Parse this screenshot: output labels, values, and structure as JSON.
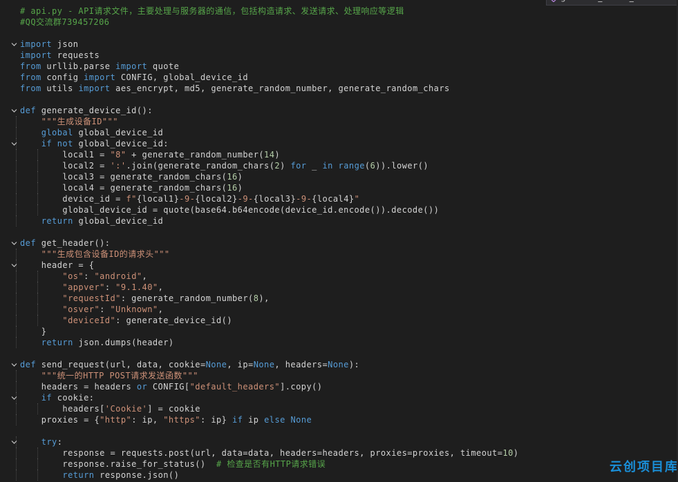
{
  "tab": {
    "label": "generate_device_id"
  },
  "watermark": "云创项目库",
  "lines": [
    {
      "segs": [
        [
          "cmt",
          "# api.py - API请求文件，主要处理与服务器的通信，包括构造请求、发送请求、处理响应等逻辑"
        ]
      ]
    },
    {
      "segs": [
        [
          "cmt",
          "#QQ交流群739457206"
        ]
      ]
    },
    {
      "segs": []
    },
    {
      "fold": true,
      "segs": [
        [
          "kw",
          "import"
        ],
        [
          "p",
          " json"
        ]
      ]
    },
    {
      "segs": [
        [
          "kw",
          "import"
        ],
        [
          "p",
          " requests"
        ]
      ]
    },
    {
      "segs": [
        [
          "kw",
          "from"
        ],
        [
          "p",
          " urllib.parse "
        ],
        [
          "kw",
          "import"
        ],
        [
          "p",
          " quote"
        ]
      ]
    },
    {
      "segs": [
        [
          "kw",
          "from"
        ],
        [
          "p",
          " config "
        ],
        [
          "kw",
          "import"
        ],
        [
          "p",
          " CONFIG, global_device_id"
        ]
      ]
    },
    {
      "segs": [
        [
          "kw",
          "from"
        ],
        [
          "p",
          " utils "
        ],
        [
          "kw",
          "import"
        ],
        [
          "p",
          " aes_encrypt, md5, generate_random_number, generate_random_chars"
        ]
      ]
    },
    {
      "segs": []
    },
    {
      "fold": true,
      "segs": [
        [
          "kw",
          "def"
        ],
        [
          "p",
          " generate_device_id():"
        ]
      ]
    },
    {
      "segs": [
        [
          "p",
          "    "
        ],
        [
          "str",
          "\"\"\"生成设备ID\"\"\""
        ]
      ]
    },
    {
      "segs": [
        [
          "p",
          "    "
        ],
        [
          "kw",
          "global"
        ],
        [
          "p",
          " global_device_id"
        ]
      ]
    },
    {
      "fold": true,
      "segs": [
        [
          "p",
          "    "
        ],
        [
          "ctl",
          "if"
        ],
        [
          "p",
          " "
        ],
        [
          "kw",
          "not"
        ],
        [
          "p",
          " global_device_id:"
        ]
      ]
    },
    {
      "segs": [
        [
          "p",
          "        local1 = "
        ],
        [
          "str",
          "\"8\""
        ],
        [
          "p",
          " + generate_random_number("
        ],
        [
          "num",
          "14"
        ],
        [
          "p",
          ")"
        ]
      ]
    },
    {
      "segs": [
        [
          "p",
          "        local2 = "
        ],
        [
          "str",
          "':'"
        ],
        [
          "p",
          ".join(generate_random_chars("
        ],
        [
          "num",
          "2"
        ],
        [
          "p",
          ") "
        ],
        [
          "ctl",
          "for"
        ],
        [
          "p",
          " _ "
        ],
        [
          "ctl",
          "in"
        ],
        [
          "p",
          " "
        ],
        [
          "kw",
          "range"
        ],
        [
          "p",
          "("
        ],
        [
          "num",
          "6"
        ],
        [
          "p",
          ")).lower()"
        ]
      ]
    },
    {
      "segs": [
        [
          "p",
          "        local3 = generate_random_chars("
        ],
        [
          "num",
          "16"
        ],
        [
          "p",
          ")"
        ]
      ]
    },
    {
      "segs": [
        [
          "p",
          "        local4 = generate_random_chars("
        ],
        [
          "num",
          "16"
        ],
        [
          "p",
          ")"
        ]
      ]
    },
    {
      "segs": [
        [
          "p",
          "        device_id = "
        ],
        [
          "str",
          "f\""
        ],
        [
          "p",
          "{local1}"
        ],
        [
          "str",
          "-9-"
        ],
        [
          "p",
          "{local2}"
        ],
        [
          "str",
          "-9-"
        ],
        [
          "p",
          "{local3}"
        ],
        [
          "str",
          "-9-"
        ],
        [
          "p",
          "{local4}"
        ],
        [
          "str",
          "\""
        ]
      ]
    },
    {
      "segs": [
        [
          "p",
          "        global_device_id = quote(base64.b64encode(device_id.encode()).decode())"
        ]
      ]
    },
    {
      "segs": [
        [
          "p",
          "    "
        ],
        [
          "ctl",
          "return"
        ],
        [
          "p",
          " global_device_id"
        ]
      ]
    },
    {
      "segs": []
    },
    {
      "fold": true,
      "segs": [
        [
          "kw",
          "def"
        ],
        [
          "p",
          " get_header():"
        ]
      ]
    },
    {
      "segs": [
        [
          "p",
          "    "
        ],
        [
          "str",
          "\"\"\"生成包含设备ID的请求头\"\"\""
        ]
      ]
    },
    {
      "fold": true,
      "segs": [
        [
          "p",
          "    header = {"
        ]
      ]
    },
    {
      "segs": [
        [
          "p",
          "        "
        ],
        [
          "str",
          "\"os\""
        ],
        [
          "p",
          ": "
        ],
        [
          "str",
          "\"android\""
        ],
        [
          "p",
          ","
        ]
      ]
    },
    {
      "segs": [
        [
          "p",
          "        "
        ],
        [
          "str",
          "\"appver\""
        ],
        [
          "p",
          ": "
        ],
        [
          "str",
          "\"9.1.40\""
        ],
        [
          "p",
          ","
        ]
      ]
    },
    {
      "segs": [
        [
          "p",
          "        "
        ],
        [
          "str",
          "\"requestId\""
        ],
        [
          "p",
          ": generate_random_number("
        ],
        [
          "num",
          "8"
        ],
        [
          "p",
          "),"
        ]
      ]
    },
    {
      "segs": [
        [
          "p",
          "        "
        ],
        [
          "str",
          "\"osver\""
        ],
        [
          "p",
          ": "
        ],
        [
          "str",
          "\"Unknown\""
        ],
        [
          "p",
          ","
        ]
      ]
    },
    {
      "segs": [
        [
          "p",
          "        "
        ],
        [
          "str",
          "\"deviceId\""
        ],
        [
          "p",
          ": generate_device_id()"
        ]
      ]
    },
    {
      "segs": [
        [
          "p",
          "    }"
        ]
      ]
    },
    {
      "segs": [
        [
          "p",
          "    "
        ],
        [
          "ctl",
          "return"
        ],
        [
          "p",
          " json.dumps(header)"
        ]
      ]
    },
    {
      "segs": []
    },
    {
      "fold": true,
      "segs": [
        [
          "kw",
          "def"
        ],
        [
          "p",
          " send_request(url, data, cookie="
        ],
        [
          "kw",
          "None"
        ],
        [
          "p",
          ", ip="
        ],
        [
          "kw",
          "None"
        ],
        [
          "p",
          ", headers="
        ],
        [
          "kw",
          "None"
        ],
        [
          "p",
          "):"
        ]
      ]
    },
    {
      "segs": [
        [
          "p",
          "    "
        ],
        [
          "str",
          "\"\"\"统一的HTTP POST请求发送函数\"\"\""
        ]
      ]
    },
    {
      "segs": [
        [
          "p",
          "    headers = headers "
        ],
        [
          "kw",
          "or"
        ],
        [
          "p",
          " CONFIG["
        ],
        [
          "str",
          "\"default_headers\""
        ],
        [
          "p",
          "].copy()"
        ]
      ]
    },
    {
      "fold": true,
      "segs": [
        [
          "p",
          "    "
        ],
        [
          "ctl",
          "if"
        ],
        [
          "p",
          " cookie:"
        ]
      ]
    },
    {
      "segs": [
        [
          "p",
          "        headers["
        ],
        [
          "str",
          "'Cookie'"
        ],
        [
          "p",
          "] = cookie"
        ]
      ]
    },
    {
      "segs": [
        [
          "p",
          "    proxies = {"
        ],
        [
          "str",
          "\"http\""
        ],
        [
          "p",
          ": ip, "
        ],
        [
          "str",
          "\"https\""
        ],
        [
          "p",
          ": ip} "
        ],
        [
          "ctl",
          "if"
        ],
        [
          "p",
          " ip "
        ],
        [
          "ctl",
          "else"
        ],
        [
          "p",
          " "
        ],
        [
          "kw",
          "None"
        ]
      ]
    },
    {
      "segs": []
    },
    {
      "fold": true,
      "segs": [
        [
          "p",
          "    "
        ],
        [
          "ctl",
          "try"
        ],
        [
          "p",
          ":"
        ]
      ]
    },
    {
      "segs": [
        [
          "p",
          "        response = requests.post(url, data=data, headers=headers, proxies=proxies, timeout="
        ],
        [
          "num",
          "10"
        ],
        [
          "p",
          ")"
        ]
      ]
    },
    {
      "segs": [
        [
          "p",
          "        response.raise_for_status()  "
        ],
        [
          "cmt",
          "# 检查是否有HTTP请求错误"
        ]
      ]
    },
    {
      "segs": [
        [
          "p",
          "        "
        ],
        [
          "ctl",
          "return"
        ],
        [
          "p",
          " response.json()"
        ]
      ]
    }
  ]
}
